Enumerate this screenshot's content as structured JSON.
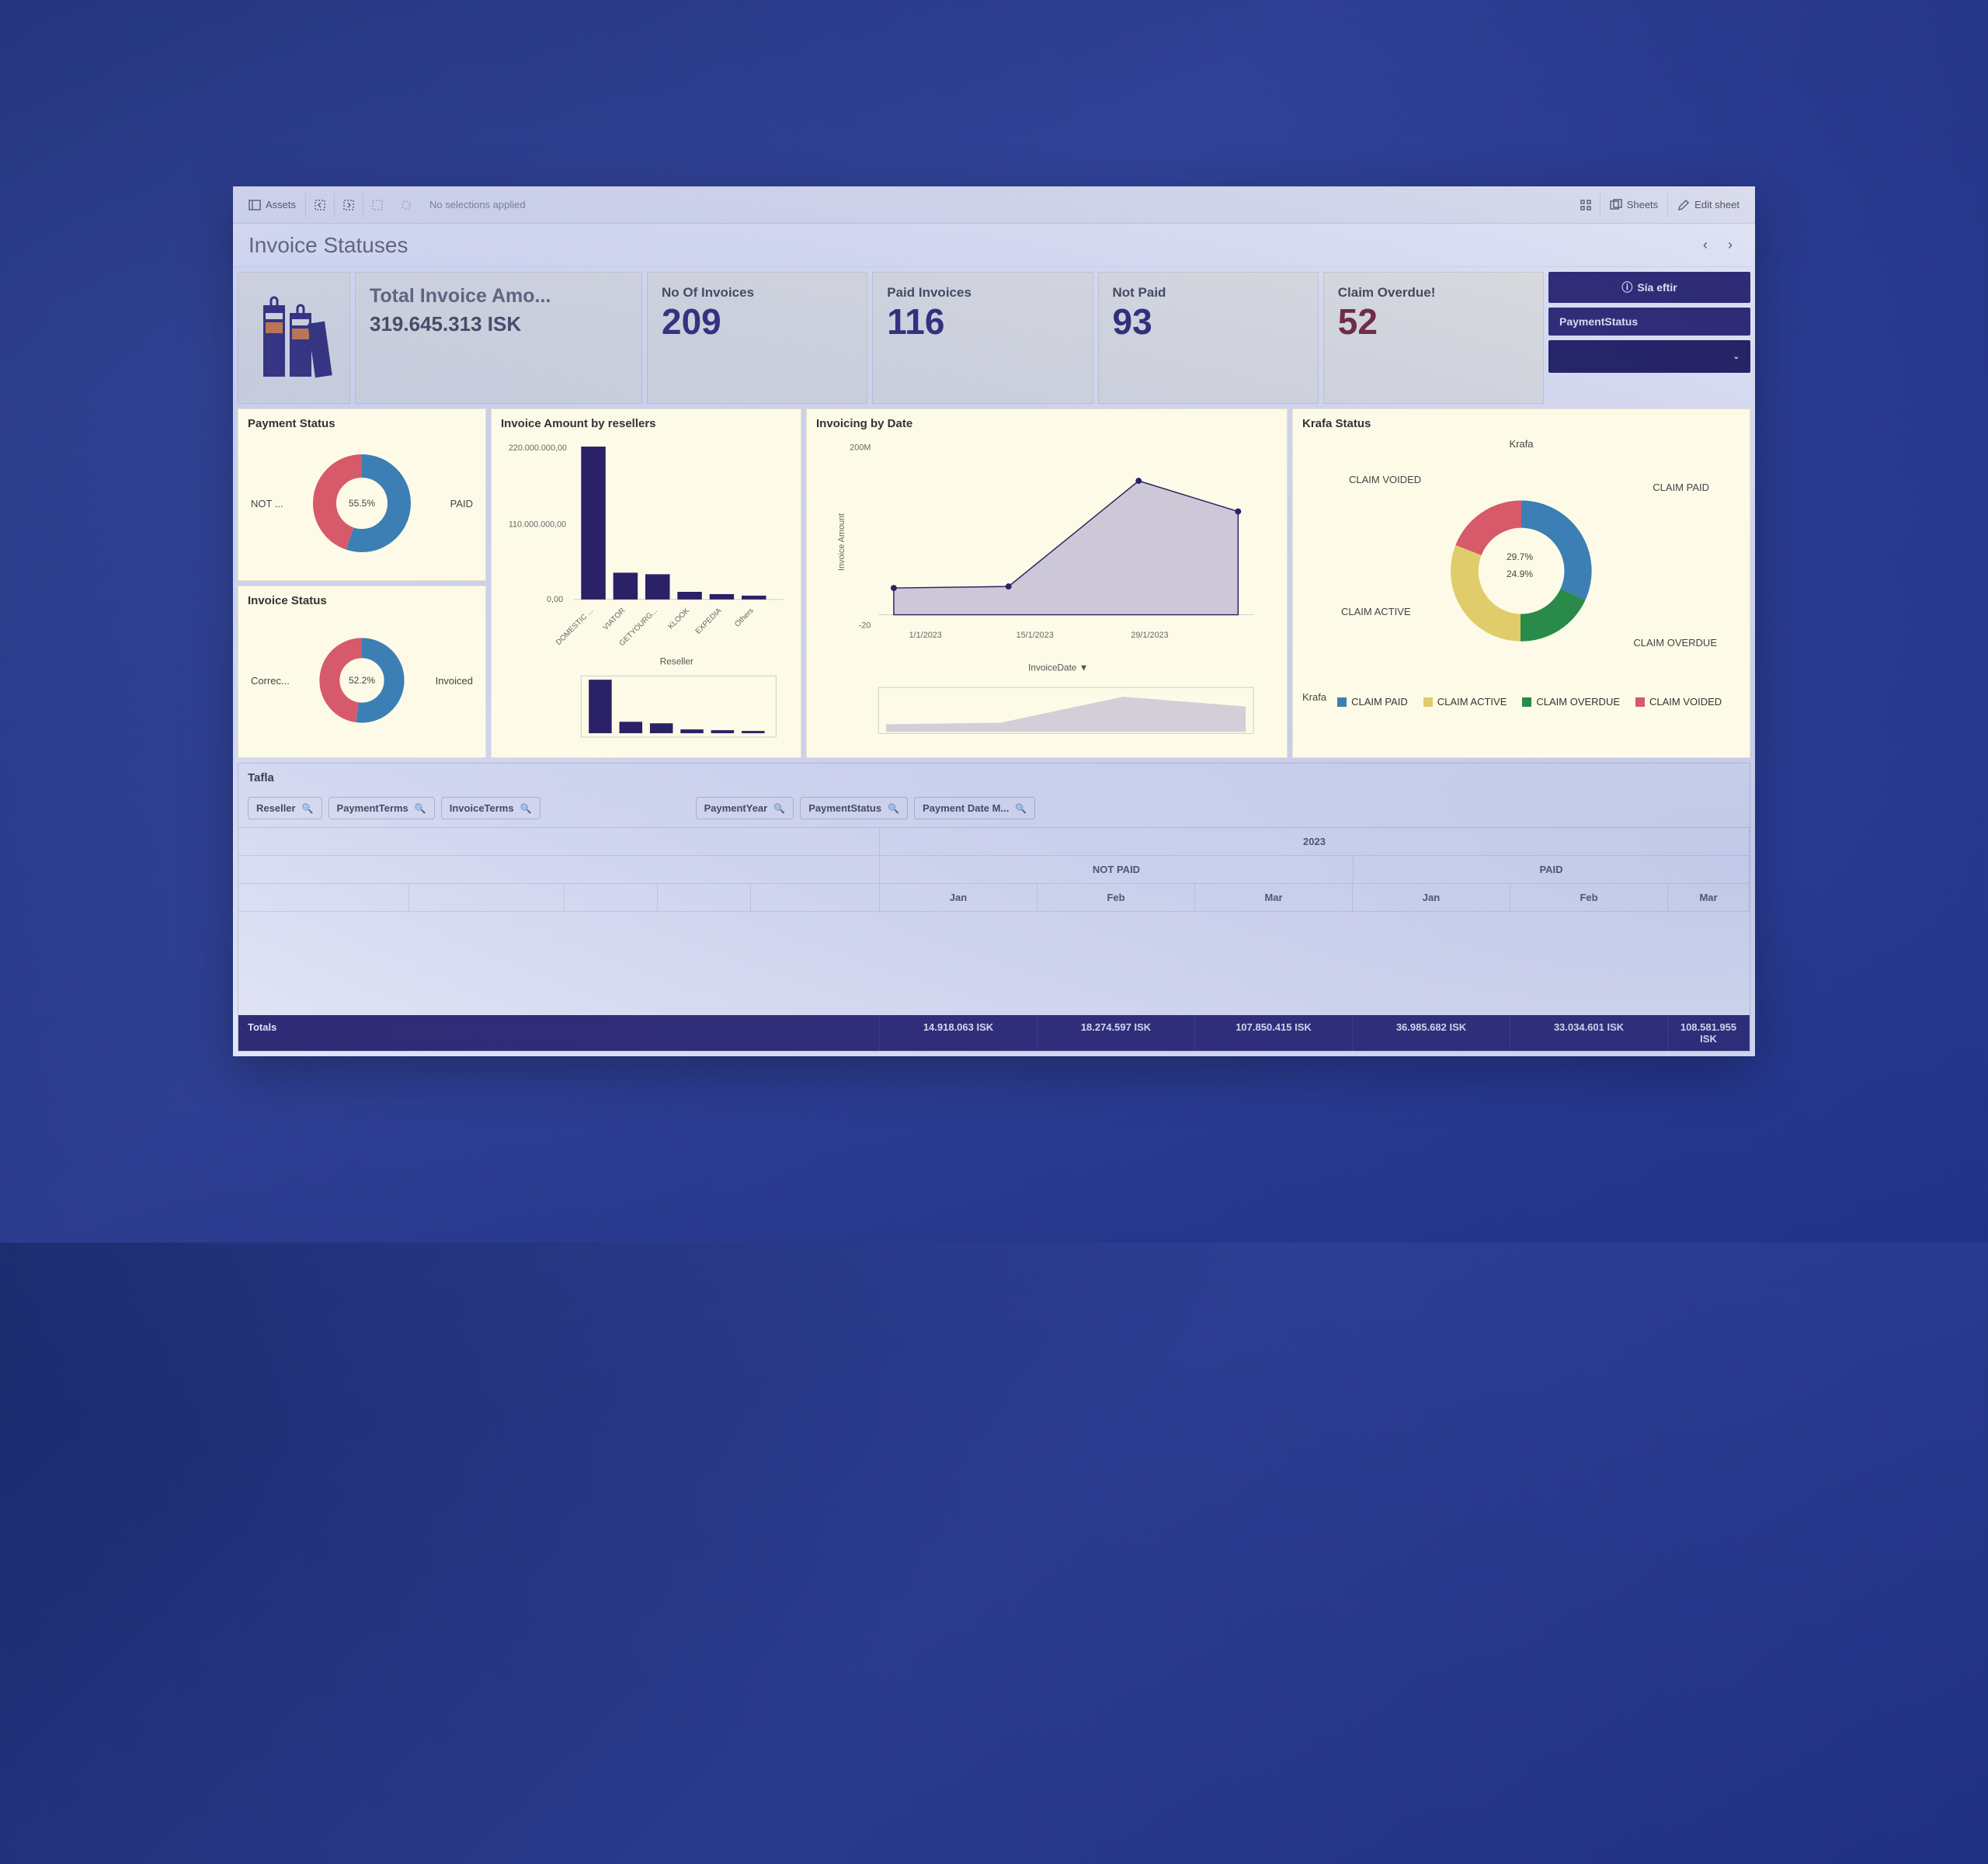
{
  "toolbar": {
    "assets": "Assets",
    "no_selections": "No selections applied",
    "sheets": "Sheets",
    "edit_sheet": "Edit sheet"
  },
  "page_title": "Invoice Statuses",
  "kpi": {
    "total_label": "Total Invoice Amo...",
    "total_value": "319.645.313 ISK",
    "invoices_label": "No Of Invoices",
    "invoices_value": "209",
    "paid_label": "Paid Invoices",
    "paid_value": "116",
    "notpaid_label": "Not Paid",
    "notpaid_value": "93",
    "overdue_label": "Claim Overdue!",
    "overdue_value": "52"
  },
  "side_filters": {
    "header": "Sía eftir",
    "payment_status": "PaymentStatus",
    "dropdown": ""
  },
  "charts": {
    "payment_status": {
      "title": "Payment Status",
      "center": "55.5%",
      "left_label": "NOT ...",
      "right_label": "PAID"
    },
    "invoice_status": {
      "title": "Invoice Status",
      "center": "52.2%",
      "left_label": "Correc...",
      "right_label": "Invoiced"
    },
    "resellers": {
      "title": "Invoice Amount by resellers",
      "xlabel": "Reseller"
    },
    "invoicing": {
      "title": "Invoicing by Date",
      "ylabel": "Invoice Amount",
      "xlabel": "InvoiceDate"
    },
    "krafa": {
      "title": "Krafa Status",
      "center_top": "29.7%",
      "center_bot": "24.9%",
      "label_top": "Krafa",
      "labels": {
        "voided": "CLAIM VOIDED",
        "paid": "CLAIM PAID",
        "active": "CLAIM ACTIVE",
        "overdue": "CLAIM OVERDUE"
      },
      "legend_title": "Krafa",
      "legend": {
        "paid": "CLAIM PAID",
        "active": "CLAIM ACTIVE",
        "overdue": "CLAIM OVERDUE",
        "voided": "CLAIM VOIDED"
      }
    }
  },
  "table": {
    "title": "Tafla",
    "pills": {
      "reseller": "Reseller",
      "payment_terms": "PaymentTerms",
      "invoice_terms": "InvoiceTerms",
      "payment_year": "PaymentYear",
      "payment_status": "PaymentStatus",
      "payment_date_m": "Payment Date M..."
    },
    "year": "2023",
    "notpaid": "NOT PAID",
    "paid": "PAID",
    "months": {
      "jan": "Jan",
      "feb": "Feb",
      "mar": "Mar"
    },
    "totals_label": "Totals",
    "totals": {
      "np_jan": "14.918.063 ISK",
      "np_feb": "18.274.597 ISK",
      "np_mar": "107.850.415 ISK",
      "p_jan": "36.985.682 ISK",
      "p_feb": "33.034.601 ISK",
      "p_mar": "108.581.955 ISK"
    }
  },
  "chart_data": [
    {
      "type": "pie",
      "title": "Payment Status",
      "series": [
        {
          "name": "PAID",
          "value": 55.5
        },
        {
          "name": "NOT PAID",
          "value": 44.5
        }
      ]
    },
    {
      "type": "pie",
      "title": "Invoice Status",
      "series": [
        {
          "name": "Invoiced",
          "value": 52.2
        },
        {
          "name": "Corrected",
          "value": 47.8
        }
      ]
    },
    {
      "type": "bar",
      "title": "Invoice Amount by resellers",
      "xlabel": "Reseller",
      "ylabel": "",
      "ylim": [
        0,
        220000000
      ],
      "categories": [
        "DOMESTIC ...",
        "VIATOR",
        "GETYOURG...",
        "KLOOK",
        "EXPEDIA",
        "Others"
      ],
      "values": [
        220000000,
        38000000,
        36000000,
        12000000,
        8000000,
        5000000
      ]
    },
    {
      "type": "area",
      "title": "Invoicing by Date",
      "xlabel": "InvoiceDate",
      "ylabel": "Invoice Amount",
      "ylim": [
        -20000000,
        200000000
      ],
      "x": [
        "1/1/2023",
        "15/1/2023",
        "29/1/2023",
        "12/2/2023"
      ],
      "values": [
        20000000,
        22000000,
        160000000,
        120000000
      ]
    },
    {
      "type": "pie",
      "title": "Krafa Status",
      "series": [
        {
          "name": "CLAIM PAID",
          "value": 29.7
        },
        {
          "name": "CLAIM OVERDUE",
          "value": 24.9
        },
        {
          "name": "CLAIM ACTIVE",
          "value": 23.0
        },
        {
          "name": "CLAIM VOIDED",
          "value": 22.4
        }
      ]
    }
  ]
}
